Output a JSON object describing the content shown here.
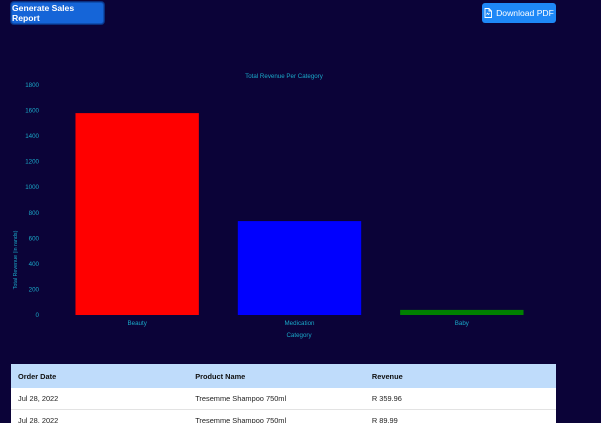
{
  "toolbar": {
    "generate_label": "Generate Sales Report",
    "download_label": "Download PDF"
  },
  "chart_data": {
    "type": "bar",
    "title": "Total Revenue Per Category",
    "xlabel": "Category",
    "ylabel": "Total Revenue (in rands)",
    "categories": [
      "Beauty",
      "Medication",
      "Baby"
    ],
    "values": [
      1580,
      735,
      40
    ],
    "colors": [
      "#ff0000",
      "#0000ff",
      "#008000"
    ],
    "ylim": [
      0,
      1800
    ],
    "yticks": [
      0,
      200,
      400,
      600,
      800,
      1000,
      1200,
      1400,
      1600,
      1800
    ],
    "grid": false
  },
  "table": {
    "headers": [
      "Order Date",
      "Product Name",
      "Revenue"
    ],
    "rows": [
      [
        "Jul 28, 2022",
        "Tresemme Shampoo 750ml",
        "R 359.96"
      ],
      [
        "Jul 28, 2022",
        "Tresemme Shampoo 750ml",
        "R 89.99"
      ]
    ]
  }
}
